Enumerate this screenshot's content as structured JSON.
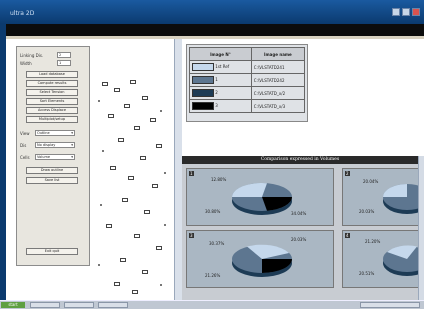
{
  "window": {
    "title": "ultra 2D"
  },
  "panel": {
    "fields": [
      {
        "label": "Linking Dis.",
        "value": "2"
      },
      {
        "label": "Width",
        "value": "1"
      }
    ],
    "buttons": [
      "Load database",
      "Compute results",
      "Select Tension",
      "Sort Elements",
      "Access Displace",
      "Multiplot/setup"
    ],
    "selects": [
      {
        "label": "View",
        "value": "Outline"
      },
      {
        "label": "Dis",
        "value": "No display"
      },
      {
        "label": "Cells",
        "value": "Volume"
      }
    ],
    "buttons2": [
      "Draw outline",
      "Save list"
    ],
    "bottom_button": "Exit quit"
  },
  "legend": {
    "headers": [
      "Image N°",
      "Image name"
    ],
    "rows": [
      {
        "index": "1st Ref",
        "name": "C:\\VLSTATD241",
        "color": "#c5d8ec"
      },
      {
        "index": "1",
        "name": "C:\\VLSTATD242",
        "color": "#5d7690"
      },
      {
        "index": "2",
        "name": "C:\\VLSTATD_x/2",
        "color": "#1d3b55"
      },
      {
        "index": "3",
        "name": "C:\\VLSTATD_x/3",
        "color": "#000000"
      }
    ]
  },
  "charts_section": {
    "title": "Comparison expressed in Volumes",
    "cards": [
      {
        "num": "1",
        "labels": [
          "12.80%",
          "30.80%",
          "34.04%"
        ]
      },
      {
        "num": "2",
        "labels": [
          "20.04%",
          "20.03%"
        ]
      },
      {
        "num": "3",
        "labels": [
          "30.37%",
          "20.03%",
          "21.26%"
        ]
      },
      {
        "num": "4",
        "labels": [
          "21.20%",
          "20.51%"
        ]
      }
    ]
  },
  "taskbar": {
    "start": "start"
  }
}
